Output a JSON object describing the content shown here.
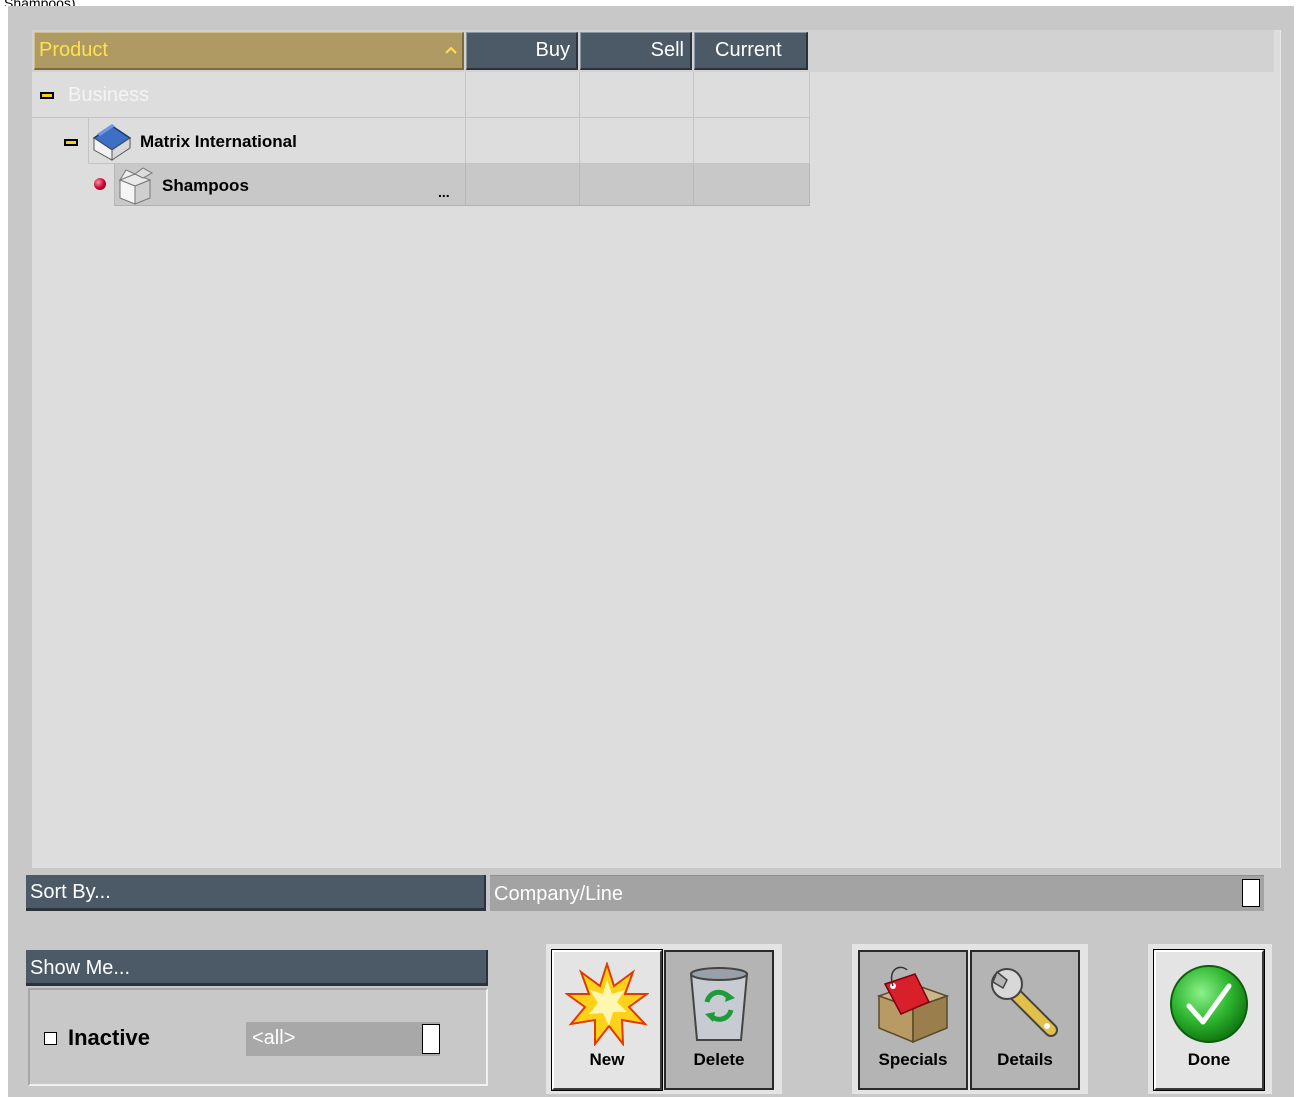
{
  "window": {
    "top_fragment": "Shampoos)"
  },
  "grid": {
    "columns": {
      "product": "Product",
      "buy": "Buy",
      "sell": "Sell",
      "current": "Current"
    },
    "rows": [
      {
        "label": "Business",
        "level": 0,
        "icon": "collapse-minus-icon"
      },
      {
        "label": "Matrix International",
        "level": 1,
        "icon": "company-house-icon"
      },
      {
        "label": "Shampoos",
        "level": 2,
        "icon": "product-box-icon",
        "status": "red-bullet",
        "more": "..."
      }
    ]
  },
  "sort": {
    "label": "Sort By...",
    "value": "Company/Line"
  },
  "show": {
    "label": "Show Me...",
    "checkbox_label": "Inactive",
    "checkbox_checked": false,
    "filter_value": "<all>"
  },
  "buttons": {
    "new": "New",
    "delete": "Delete",
    "specials": "Specials",
    "details": "Details",
    "done": "Done"
  },
  "colors": {
    "header": "#4c5966",
    "header_active": "#b09a64",
    "header_active_text": "#ffe14a",
    "background": "#c8c8c8",
    "grid": "#dddddd",
    "done_green": "#2db52d"
  }
}
